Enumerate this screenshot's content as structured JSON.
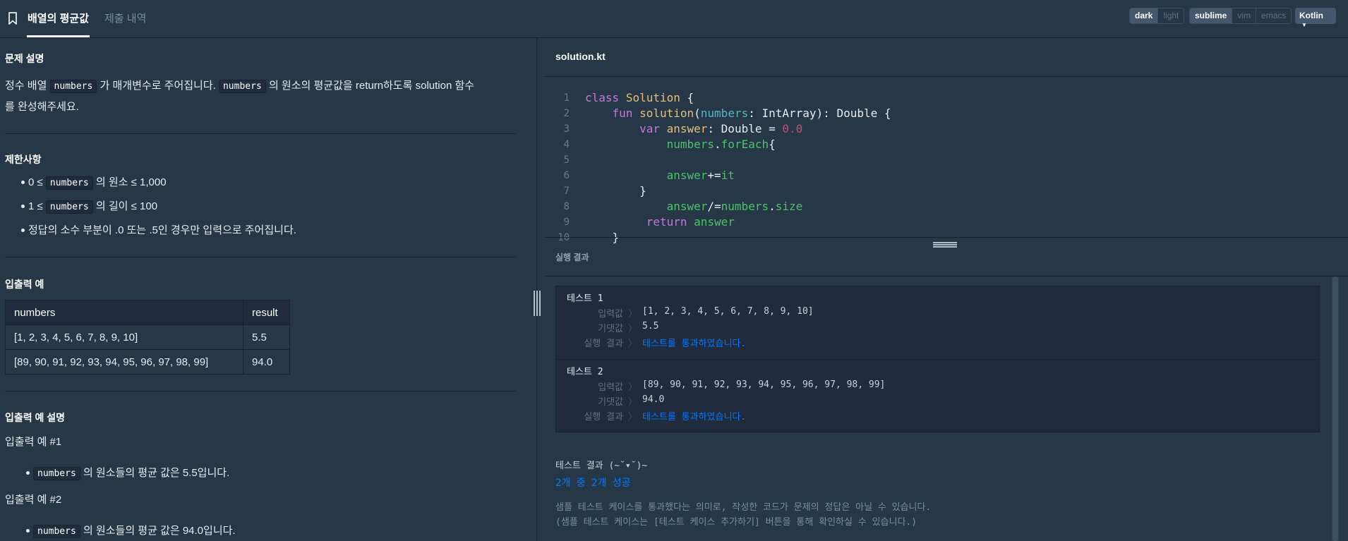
{
  "header": {
    "problem_tab": "배열의 평균값",
    "submissions_tab": "제출 내역",
    "theme_options": [
      {
        "label": "dark",
        "active": true
      },
      {
        "label": "light",
        "active": false
      }
    ],
    "keymap_options": [
      {
        "label": "sublime",
        "active": true
      },
      {
        "label": "vim",
        "active": false
      },
      {
        "label": "emacs",
        "active": false
      }
    ],
    "language": "Kotlin"
  },
  "problem": {
    "description_title": "문제 설명",
    "description": {
      "t1": "정수 배열 ",
      "c1": "numbers",
      "t2": " 가 매개변수로 주어집니다. ",
      "c2": "numbers",
      "t3": " 의 원소의 평균값을 return하도록 solution 함수",
      "t4": "를 완성해주세요."
    },
    "constraints_title": "제한사항",
    "constraints": [
      {
        "pre": "0 ≤ ",
        "code": "numbers",
        "post": " 의 원소 ≤ 1,000"
      },
      {
        "pre": "1 ≤ ",
        "code": "numbers",
        "post": " 의 길이 ≤ 100"
      },
      {
        "pre": "정답의 소수 부분이 .0 또는 .5인 경우만 입력으로 주어집니다.",
        "code": "",
        "post": ""
      }
    ],
    "examples_title": "입출력 예",
    "examples_table": {
      "headers": [
        "numbers",
        "result"
      ],
      "rows": [
        [
          "[1, 2, 3, 4, 5, 6, 7, 8, 9, 10]",
          "5.5"
        ],
        [
          "[89, 90, 91, 92, 93, 94, 95, 96, 97, 98, 99]",
          "94.0"
        ]
      ]
    },
    "explanation_title": "입출력 예 설명",
    "explanations": [
      {
        "heading": "입출력 예 #1",
        "code": "numbers",
        "text": " 의 원소들의 평균 값은 5.5입니다."
      },
      {
        "heading": "입출력 예 #2",
        "code": "numbers",
        "text": " 의 원소들의 평균 값은 94.0입니다."
      }
    ]
  },
  "editor": {
    "filename": "solution.kt",
    "line_numbers": [
      "1",
      "2",
      "3",
      "4",
      "5",
      "6",
      "7",
      "8",
      "9",
      "10"
    ]
  },
  "results": {
    "title": "실행 결과",
    "tests": [
      {
        "name": "테스트 1",
        "input_label": "입력값",
        "input": "[1, 2, 3, 4, 5, 6, 7, 8, 9, 10]",
        "expected_label": "기댓값",
        "expected": "5.5",
        "result_label": "실행 결과",
        "result": "테스트를 통과하였습니다."
      },
      {
        "name": "테스트 2",
        "input_label": "입력값",
        "input": "[89, 90, 91, 92, 93, 94, 95, 96, 97, 98, 99]",
        "expected_label": "기댓값",
        "expected": "94.0",
        "result_label": "실행 결과",
        "result": "테스트를 통과하였습니다."
      }
    ],
    "summary": "테스트 결과 (~˘▾˘)~",
    "score": "2개 중 2개 성공",
    "note_line1": "샘플 테스트 케이스를 통과했다는 의미로, 작성한 코드가 문제의 정답은 아닐 수 있습니다.",
    "note_line2": "(샘플 테스트 케이스는 [테스트 케이스 추가하기] 버튼을 통해 확인하실 수 있습니다.)"
  },
  "colors": {
    "background": "#263747",
    "panel_dark": "#202b3d",
    "border": "#172334",
    "pass_blue": "#0078ff",
    "keyword": "#c678dd",
    "class_name": "#e5c07b",
    "identifier": "#4ec26b",
    "number": "#c24e7a"
  }
}
